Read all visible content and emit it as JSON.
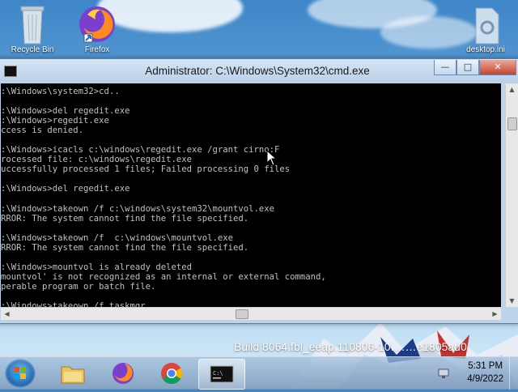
{
  "desktop": {
    "icons": [
      {
        "label": "Recycle Bin",
        "icon": "recycle-bin-icon"
      },
      {
        "label": "Firefox",
        "icon": "firefox-icon"
      },
      {
        "label": "desktop.ini",
        "icon": "settings-file-icon"
      }
    ],
    "build_text": "Build 8064.fbl_eeap.110806-10.……e1805ad0"
  },
  "window": {
    "title": "Administrator: C:\\Windows\\System32\\cmd.exe",
    "buttons": {
      "minimize": "—",
      "maximize": "□",
      "close": "✕"
    },
    "console_lines": [
      ":\\Windows\\system32>cd..",
      "",
      ":\\Windows>del regedit.exe",
      ":\\Windows>regedit.exe",
      "ccess is denied.",
      "",
      ":\\Windows>icacls c:\\windows\\regedit.exe /grant cirno:F",
      "rocessed file: c:\\windows\\regedit.exe",
      "uccessfully processed 1 files; Failed processing 0 files",
      "",
      ":\\Windows>del regedit.exe",
      "",
      ":\\Windows>takeown /f c:\\windows\\system32\\mountvol.exe",
      "RROR: The system cannot find the file specified.",
      "",
      ":\\Windows>takeown /f  c:\\windows\\mountvol.exe",
      "RROR: The system cannot find the file specified.",
      "",
      ":\\Windows>mountvol is already deleted",
      "mountvol' is not recognized as an internal or external command,",
      "perable program or batch file.",
      "",
      ":\\Windows>takeown /f taskmgr"
    ]
  },
  "taskbar": {
    "items": [
      {
        "name": "explorer",
        "icon": "folder-icon"
      },
      {
        "name": "firefox",
        "icon": "firefox-icon"
      },
      {
        "name": "chrome",
        "icon": "chrome-icon"
      },
      {
        "name": "cmd",
        "icon": "cmd-icon"
      }
    ],
    "clock": {
      "time": "5:31 PM",
      "date": "4/9/2022"
    }
  }
}
